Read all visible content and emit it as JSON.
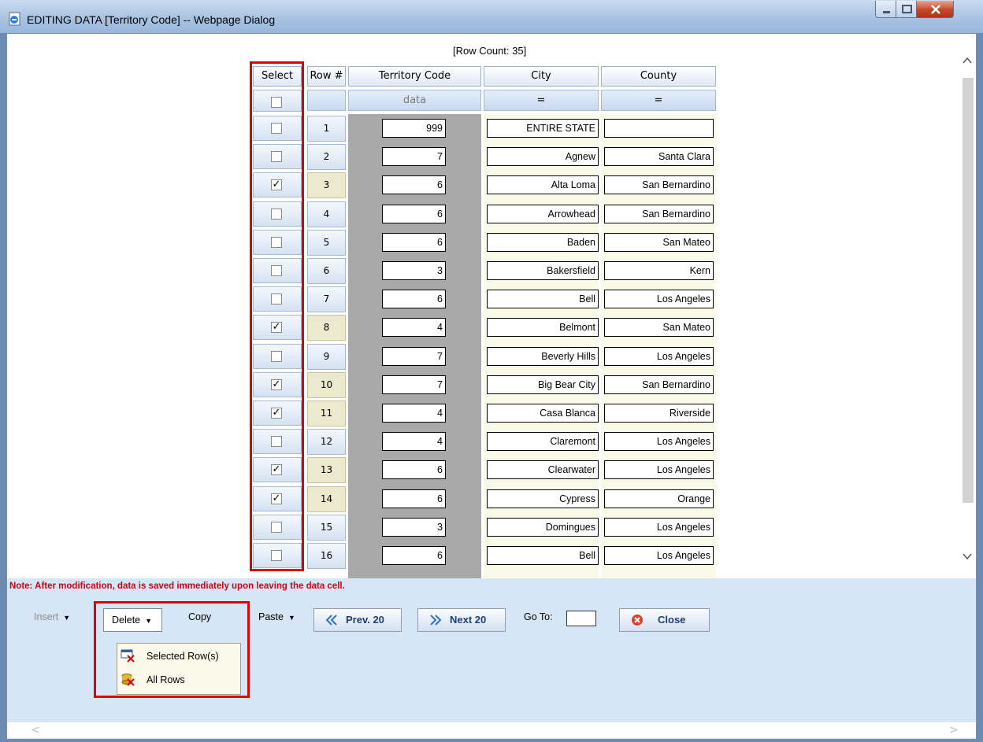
{
  "window": {
    "title": "EDITING DATA [Territory Code] -- Webpage Dialog"
  },
  "row_count": "[Row Count: 35]",
  "columns": [
    "Select",
    "Row #",
    "Territory Code",
    "City",
    "County"
  ],
  "filters": [
    "data",
    "=",
    "="
  ],
  "rows": [
    {
      "num": "1",
      "checked": false,
      "code": "999",
      "city": "ENTIRE STATE",
      "county": ""
    },
    {
      "num": "2",
      "checked": false,
      "code": "7",
      "city": "Agnew",
      "county": "Santa Clara"
    },
    {
      "num": "3",
      "checked": true,
      "code": "6",
      "city": "Alta Loma",
      "county": "San Bernardino"
    },
    {
      "num": "4",
      "checked": false,
      "code": "6",
      "city": "Arrowhead",
      "county": "San Bernardino"
    },
    {
      "num": "5",
      "checked": false,
      "code": "6",
      "city": "Baden",
      "county": "San Mateo"
    },
    {
      "num": "6",
      "checked": false,
      "code": "3",
      "city": "Bakersfield",
      "county": "Kern"
    },
    {
      "num": "7",
      "checked": false,
      "code": "6",
      "city": "Bell",
      "county": "Los Angeles"
    },
    {
      "num": "8",
      "checked": true,
      "code": "4",
      "city": "Belmont",
      "county": "San Mateo"
    },
    {
      "num": "9",
      "checked": false,
      "code": "7",
      "city": "Beverly Hills",
      "county": "Los Angeles"
    },
    {
      "num": "10",
      "checked": true,
      "code": "7",
      "city": "Big Bear City",
      "county": "San Bernardino"
    },
    {
      "num": "11",
      "checked": true,
      "code": "4",
      "city": "Casa Blanca",
      "county": "Riverside"
    },
    {
      "num": "12",
      "checked": false,
      "code": "4",
      "city": "Claremont",
      "county": "Los Angeles"
    },
    {
      "num": "13",
      "checked": true,
      "code": "6",
      "city": "Clearwater",
      "county": "Los Angeles"
    },
    {
      "num": "14",
      "checked": true,
      "code": "6",
      "city": "Cypress",
      "county": "Orange"
    },
    {
      "num": "15",
      "checked": false,
      "code": "3",
      "city": "Domingues",
      "county": "Los Angeles"
    },
    {
      "num": "16",
      "checked": false,
      "code": "6",
      "city": "Bell",
      "county": "Los Angeles"
    }
  ],
  "note": "Note: After modification, data is saved immediately upon leaving the data cell.",
  "toolbar": {
    "insert": "Insert",
    "delete": "Delete",
    "copy": "Copy",
    "paste": "Paste",
    "prev": "Prev. 20",
    "next": "Next 20",
    "goto_label": "Go To:",
    "goto_value": "",
    "close": "Close"
  },
  "delete_menu": [
    "Selected Row(s)",
    "All Rows"
  ],
  "icons": {
    "window": "ie-page-icon",
    "prev": "double-chevron-left-icon",
    "next": "double-chevron-right-icon",
    "close": "close-x-circle-icon",
    "selected_rows": "delete-rows-icon",
    "all_rows": "delete-all-icon"
  },
  "colors": {
    "note": "#d7000f",
    "highlight_box": "#e00000",
    "selected_row": "#ece9cf",
    "button_text": "#1b3f74"
  }
}
